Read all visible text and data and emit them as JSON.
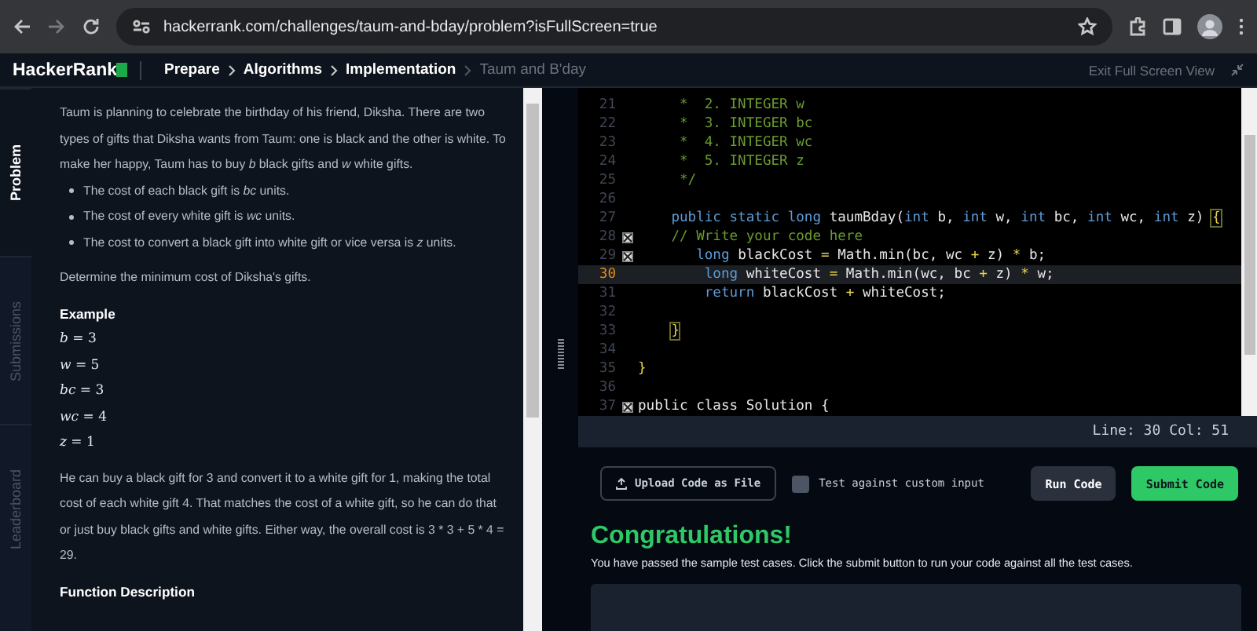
{
  "browser": {
    "url": "hackerrank.com/challenges/taum-and-bday/problem?isFullScreen=true"
  },
  "header": {
    "logo": "HackerRank",
    "breadcrumbs": [
      {
        "label": "Prepare",
        "current": false
      },
      {
        "label": "Algorithms",
        "current": false
      },
      {
        "label": "Implementation",
        "current": false
      },
      {
        "label": "Taum and B'day",
        "current": true
      }
    ],
    "exit": "Exit Full Screen View"
  },
  "side_tabs": [
    {
      "label": "Problem",
      "selected": true
    },
    {
      "label": "Submissions",
      "selected": false
    },
    {
      "label": "Leaderboard",
      "selected": false
    }
  ],
  "problem": {
    "intro": "Taum is planning to celebrate the birthday of his friend, Diksha. There are two types of gifts that Diksha wants from Taum: one is black and the other is white. To make her happy, Taum has to buy *b* black gifts and *w* white gifts.",
    "bullets": [
      "The cost of each black gift is *bc* units.",
      "The cost of every white gift is *wc* units.",
      "The cost to convert a black gift into white gift or vice versa is *z* units."
    ],
    "determine": "Determine the minimum cost of Diksha's gifts.",
    "example_heading": "Example",
    "example_values": [
      "*b* = 3",
      "*w* = 5",
      "*bc* = 3",
      "*wc* = 4",
      "*z* = 1"
    ],
    "explanation": "He can buy a black gift for 3 and convert it to a white gift for 1, making the total cost of each white gift 4. That matches the cost of a white gift, so he can do that or just buy black gifts and white gifts. Either way, the overall cost is 3 * 3 + 5 * 4 = 29.",
    "section_heading": "Function Description"
  },
  "editor": {
    "lines": [
      {
        "number": "21",
        "marker": false,
        "current": false,
        "tokens": [
          {
            "kind": "comment",
            "text": "     *  2. INTEGER w"
          }
        ]
      },
      {
        "number": "22",
        "marker": false,
        "current": false,
        "tokens": [
          {
            "kind": "comment",
            "text": "     *  3. INTEGER bc"
          }
        ]
      },
      {
        "number": "23",
        "marker": false,
        "current": false,
        "tokens": [
          {
            "kind": "comment",
            "text": "     *  4. INTEGER wc"
          }
        ]
      },
      {
        "number": "24",
        "marker": false,
        "current": false,
        "tokens": [
          {
            "kind": "comment",
            "text": "     *  5. INTEGER z"
          }
        ]
      },
      {
        "number": "25",
        "marker": false,
        "current": false,
        "tokens": [
          {
            "kind": "comment",
            "text": "     */"
          }
        ]
      },
      {
        "number": "26",
        "marker": false,
        "current": false
      },
      {
        "number": "27",
        "marker": false,
        "current": false,
        "tokens": [
          {
            "kind": "keyword",
            "text": "    public static long "
          },
          {
            "kind": "plain",
            "text": "taumBday("
          },
          {
            "kind": "keyword",
            "text": "int"
          },
          {
            "kind": "plain",
            "text": " b, "
          },
          {
            "kind": "keyword",
            "text": "int"
          },
          {
            "kind": "plain",
            "text": " w, "
          },
          {
            "kind": "keyword",
            "text": "int"
          },
          {
            "kind": "plain",
            "text": " bc, "
          },
          {
            "kind": "keyword",
            "text": "int"
          },
          {
            "kind": "plain",
            "text": " wc, "
          },
          {
            "kind": "keyword",
            "text": "int"
          },
          {
            "kind": "plain",
            "text": " z) "
          },
          {
            "kind": "brace",
            "text": "{"
          }
        ]
      },
      {
        "number": "28",
        "marker": true,
        "current": false,
        "tokens": [
          {
            "kind": "comment",
            "text": "    // Write your code here"
          }
        ]
      },
      {
        "number": "29",
        "marker": true,
        "current": false,
        "tokens": [
          {
            "kind": "keyword",
            "text": "       long"
          },
          {
            "kind": "plain",
            "text": " blackCost "
          },
          {
            "kind": "operator",
            "text": "="
          },
          {
            "kind": "plain",
            "text": " Math.min(bc, wc "
          },
          {
            "kind": "operator",
            "text": "+"
          },
          {
            "kind": "plain",
            "text": " z) "
          },
          {
            "kind": "operator",
            "text": "*"
          },
          {
            "kind": "plain",
            "text": " b;"
          }
        ]
      },
      {
        "number": "30",
        "marker": false,
        "current": true,
        "tokens": [
          {
            "kind": "keyword",
            "text": "        long"
          },
          {
            "kind": "plain",
            "text": " whiteCost "
          },
          {
            "kind": "operator",
            "text": "="
          },
          {
            "kind": "plain",
            "text": " Math.min(wc, bc "
          },
          {
            "kind": "operator",
            "text": "+"
          },
          {
            "kind": "plain",
            "text": " z) "
          },
          {
            "kind": "operator",
            "text": "*"
          },
          {
            "kind": "plain",
            "text": " w;"
          }
        ]
      },
      {
        "number": "31",
        "marker": false,
        "current": false,
        "tokens": [
          {
            "kind": "keyword",
            "text": "        return"
          },
          {
            "kind": "plain",
            "text": " blackCost "
          },
          {
            "kind": "operator",
            "text": "+"
          },
          {
            "kind": "plain",
            "text": " whiteCost;"
          }
        ]
      },
      {
        "number": "32",
        "marker": false,
        "current": false
      },
      {
        "number": "33",
        "marker": false,
        "current": false,
        "tokens": [
          {
            "kind": "brace",
            "text": "    }"
          }
        ]
      },
      {
        "number": "34",
        "marker": false,
        "current": false
      },
      {
        "number": "35",
        "marker": false,
        "current": false,
        "tokens": [
          {
            "kind": "operator",
            "text": "}"
          }
        ]
      },
      {
        "number": "36",
        "marker": false,
        "current": false
      },
      {
        "number": "37",
        "marker": true,
        "current": false,
        "tokens": [
          {
            "kind": "plain",
            "text": "public class Solution {"
          }
        ]
      }
    ],
    "status": "Line: 30 Col: 51"
  },
  "actions": {
    "upload": "Upload Code as File",
    "custom_input": {
      "label": "Test against custom input",
      "checked": false
    },
    "run": "Run Code",
    "submit": "Submit Code"
  },
  "result": {
    "title": "Congratulations!",
    "message": "You have passed the sample test cases. Click the submit button to run your code against all the test cases."
  }
}
